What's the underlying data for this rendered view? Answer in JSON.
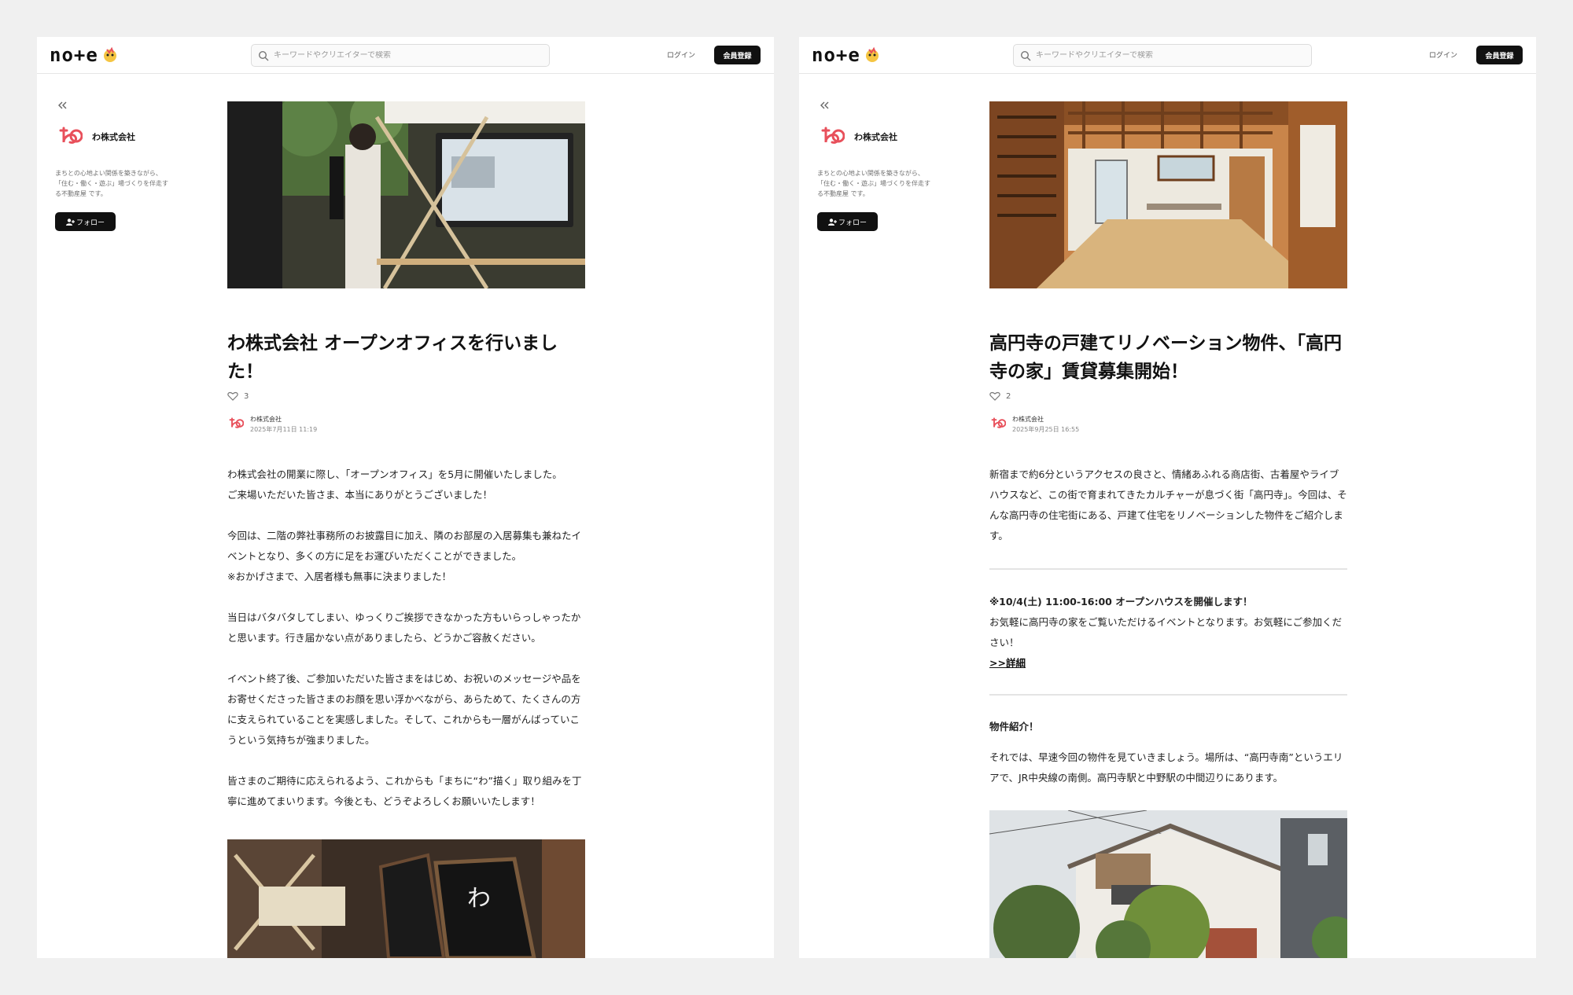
{
  "site": {
    "logo_text": "no+e",
    "search_placeholder": "キーワードやクリエイターで検索",
    "login_label": "ログイン",
    "signup_label": "会員登録"
  },
  "creator": {
    "name": "わ株式会社",
    "description": "まちとの心地よい関係を築きながら、「住む・働く・遊ぶ」場づくりを伴走する不動産屋 です。",
    "follow_label": "フォロー"
  },
  "articles": [
    {
      "title": "わ株式会社 オープンオフィスを行いました！",
      "likes": "3",
      "author": "わ株式会社",
      "date": "2025年7月11日 11:19",
      "paragraphs": [
        "わ株式会社の開業に際し、「オープンオフィス」を5月に開催いたしました。\nご来場いただいた皆さま、本当にありがとうございました！",
        "今回は、二階の弊社事務所のお披露目に加え、隣のお部屋の入居募集も兼ねたイベントとなり、多くの方に足をお運びいただくことができました。\n※おかげさまで、入居者様も無事に決まりました！",
        "当日はバタバタしてしまい、ゆっくりご挨拶できなかった方もいらっしゃったかと思います。行き届かない点がありましたら、どうかご容赦ください。",
        "イベント終了後、ご参加いただいた皆さまをはじめ、お祝いのメッセージや品をお寄せくださった皆さまのお顔を思い浮かべながら、あらためて、たくさんの方に支えられていることを実感しました。そして、これからも一層がんばっていこうという気持ちが強まりました。",
        "皆さまのご期待に応えられるよう、これからも「まちに“わ”描く」取り組みを丁寧に進めてまいります。今後とも、どうぞよろしくお願いいたします！"
      ]
    },
    {
      "title": "高円寺の戸建てリノベーション物件、「高円寺の家」賃貸募集開始！",
      "likes": "2",
      "author": "わ株式会社",
      "date": "2025年9月25日 16:55",
      "intro": "新宿まで約6分というアクセスの良さと、情緒あふれる商店街、古着屋やライブハウスなど、この街で育まれてきたカルチャーが息づく街「高円寺」。今回は、そんな高円寺の住宅街にある、戸建て住宅をリノベーションした物件をご紹介します。",
      "openhouse_heading": "※10/4(土) 11:00-16:00 オープンハウスを開催します！",
      "openhouse_text": "お気軽に高円寺の家をご覧いただけるイベントとなります。お気軽にご参加ください！",
      "detail_link": ">>詳細",
      "section_heading": "物件紹介！",
      "section_text": "それでは、早速今回の物件を見ていきましょう。場所は、“高円寺南”というエリアで、JR中央線の南側。高円寺駅と中野駅の中間辺りにあります。"
    }
  ],
  "icons": [
    "note-mascot-icon",
    "search-icon",
    "collapse-icon",
    "follow-user-icon",
    "heart-icon"
  ],
  "colors": {
    "brand_red": "#e8505b",
    "button_dark": "#111111"
  }
}
